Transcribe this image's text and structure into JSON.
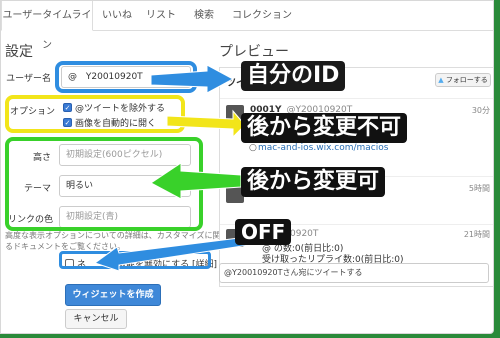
{
  "tabs": [
    {
      "label": "ユーザータイムライン",
      "active": true
    },
    {
      "label": "いいね",
      "active": false
    },
    {
      "label": "リスト",
      "active": false
    },
    {
      "label": "検索",
      "active": false
    },
    {
      "label": "コレクション",
      "active": false
    }
  ],
  "settings": {
    "title": "設定",
    "username_label": "ユーザー名",
    "username_prefix": "@",
    "username_value": "Y20010920T",
    "options_label": "オプション",
    "option_exclude_replies": "@ツイートを除外する",
    "option_auto_expand": "画像を自動的に開く",
    "height_label": "高さ",
    "height_placeholder": "初期設定(600ピクセル)",
    "theme_label": "テーマ",
    "theme_value": "明るい",
    "link_color_label": "リンクの色",
    "link_color_placeholder": "初期設定(青)",
    "help_text_line1": "高度な表示オプションについての詳細は、カスタマイズに関す",
    "help_text_line2": "るドキュメントをご覧ください。",
    "disable_features_label": "ネ",
    "disable_features_suffix": "ス機能を無効にする [詳細]",
    "create_button": "ウィジェットを作成",
    "cancel_button": "キャンセル"
  },
  "preview": {
    "title": "プレビュー",
    "header_label": "ツイ",
    "follow_button": "フォローする",
    "tweets": [
      {
        "name": "0001Y",
        "handle": "@Y20010920T",
        "time": "30分",
        "text": "",
        "link": "mac-and-ios.wix.com/macios"
      },
      {
        "name": "",
        "handle": "",
        "time": "5時間",
        "text": "",
        "link": ""
      },
      {
        "name": "",
        "handle": "0920T",
        "time": "21時間",
        "text": "@ の数:0(前日比:0)",
        "text2": "受け取ったリプライ数:0(前日比:0)",
        "link": ""
      }
    ],
    "reply_placeholder": "@Y20010920Tさん宛にツイートする"
  },
  "annotations": {
    "id_label": "自分のID",
    "immutable_label": "後から変更不可",
    "mutable_label": "後から変更可",
    "off_label": "OFF"
  },
  "colors": {
    "border": "#2a8a3a",
    "blue_highlight": "#2f8de0",
    "yellow_highlight": "#f2e51a",
    "green_highlight": "#39d12a",
    "primary_button": "#3f88d8"
  },
  "icons": {
    "twitter_bird": "twitter-bird-icon",
    "globe": "globe-icon"
  }
}
